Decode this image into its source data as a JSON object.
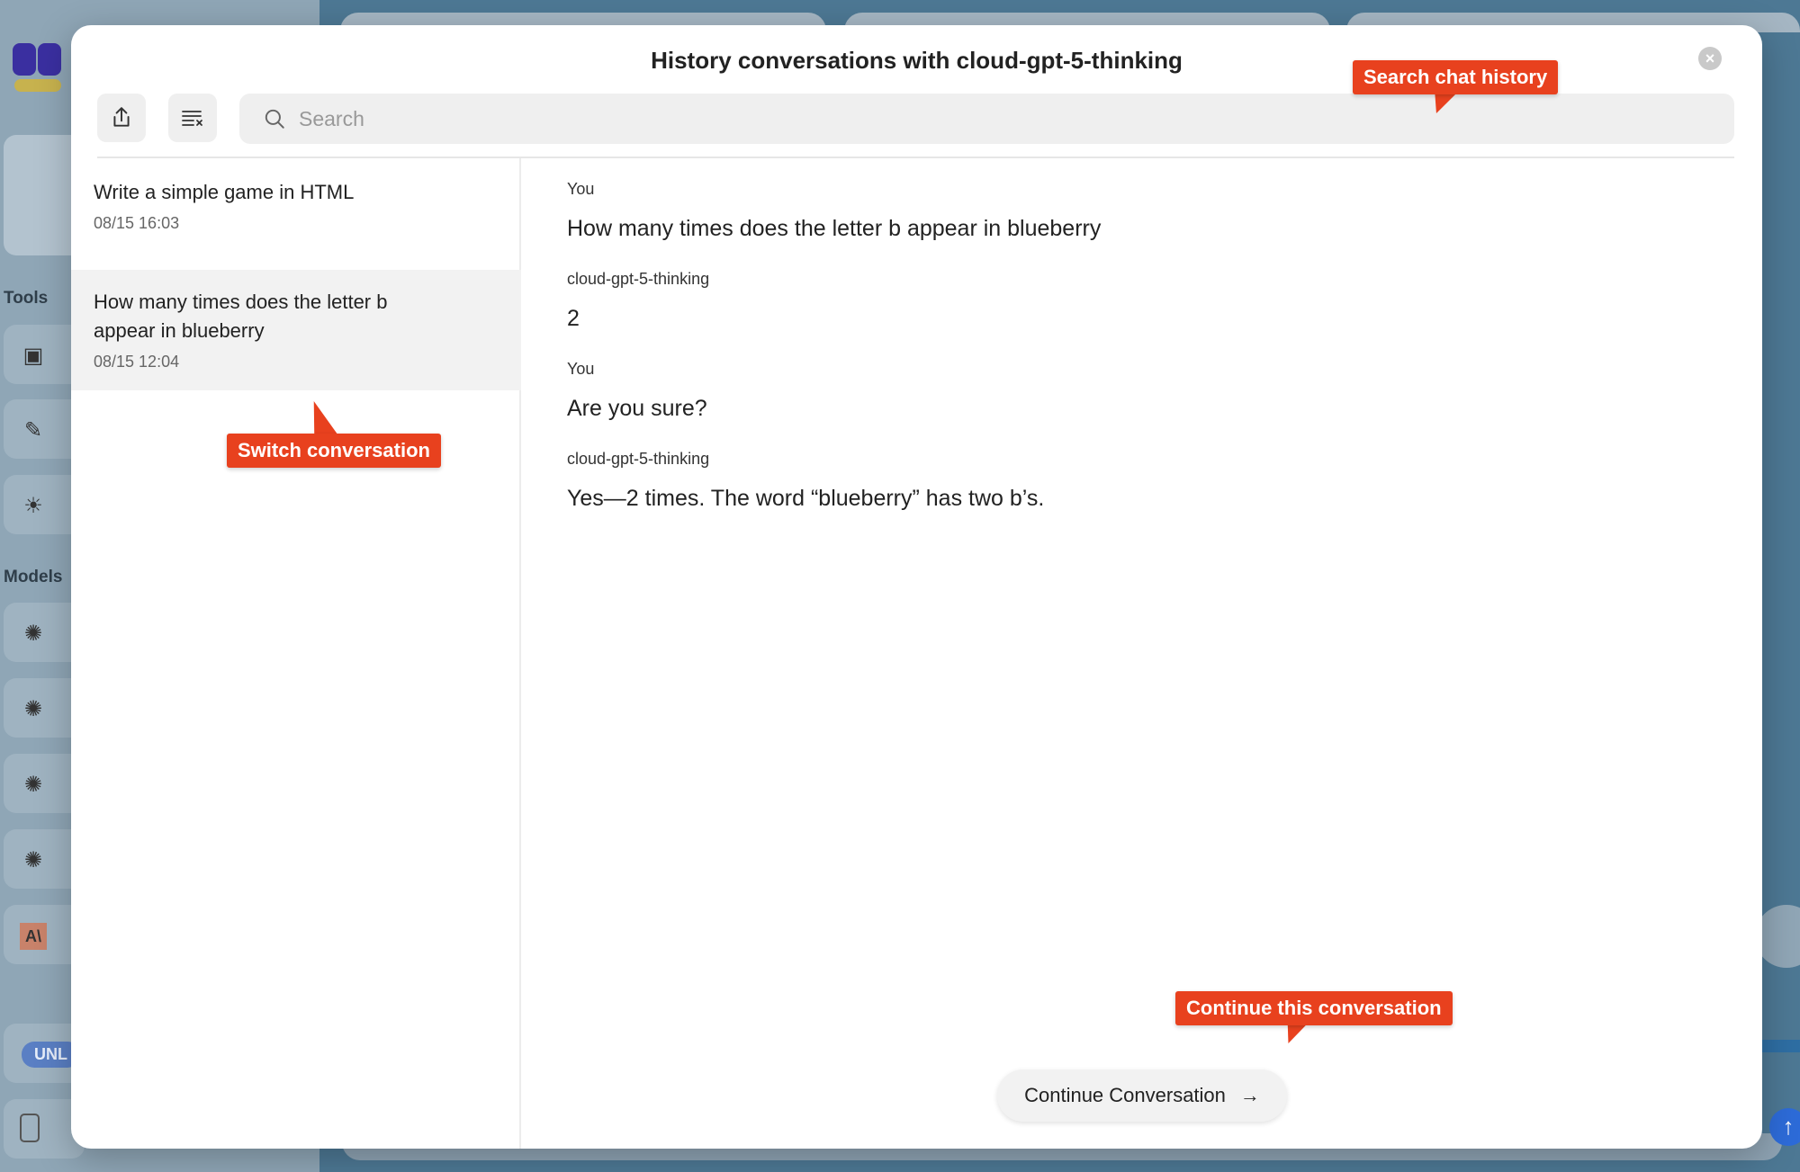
{
  "background": {
    "sections": [
      "Tools",
      "Models"
    ],
    "badge": "UNL",
    "send_icon": "arrow-up-icon"
  },
  "modal": {
    "title": "History conversations with cloud-gpt-5-thinking",
    "close_icon": "close-icon",
    "toolbar": {
      "export_icon": "share-export-icon",
      "clear_icon": "clear-list-icon"
    },
    "search": {
      "placeholder": "Search",
      "value": "",
      "icon": "search-icon"
    },
    "conversations": [
      {
        "title": "Write a simple game in HTML",
        "date": "08/15 16:03",
        "selected": false
      },
      {
        "title": "How many times does the letter b appear in blueberry",
        "date": "08/15 12:04",
        "selected": true
      }
    ],
    "messages": [
      {
        "author": "You",
        "text": "How many times does the letter b appear in blueberry"
      },
      {
        "author": "cloud-gpt-5-thinking",
        "text": "2"
      },
      {
        "author": "You",
        "text": "Are you sure?"
      },
      {
        "author": "cloud-gpt-5-thinking",
        "text": "Yes—2 times. The word “blueberry” has two b’s."
      }
    ],
    "continue_button": {
      "label": "Continue Conversation",
      "icon": "arrow-right-icon"
    }
  },
  "callouts": {
    "search": "Search chat history",
    "switch": "Switch conversation",
    "continue": "Continue this conversation"
  },
  "colors": {
    "callout": "#e8411e",
    "overlay": "#4d7894",
    "selected_item": "#f2f2f2"
  }
}
